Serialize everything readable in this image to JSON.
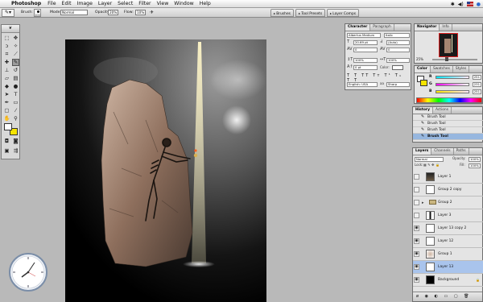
{
  "menubar": {
    "app_name": "Photoshop",
    "items": [
      "File",
      "Edit",
      "Image",
      "Layer",
      "Select",
      "Filter",
      "View",
      "Window",
      "Help"
    ]
  },
  "options_bar": {
    "brush_label": "Brush:",
    "brush_size": "200",
    "mode_label": "Mode:",
    "mode_value": "Normal",
    "opacity_label": "Opacity:",
    "opacity_value": "20%",
    "flow_label": "Flow:",
    "flow_value": "10%",
    "well_tabs": [
      "Brushes",
      "Tool Presets",
      "Layer Comps"
    ]
  },
  "character_palette": {
    "tabs": [
      "Character",
      "Paragraph"
    ],
    "font_family": "Albertus Medium",
    "font_style": "Italic",
    "font_size": "20.69 pt",
    "leading": "(Auto)",
    "kerning": "0",
    "tracking": "0",
    "vertical_scale": "100%",
    "horizontal_scale": "100%",
    "baseline_shift": "0 pt",
    "color_label": "Color:",
    "language": "English: USA",
    "antialias": "Sharp"
  },
  "navigator_palette": {
    "tabs": [
      "Navigator",
      "Info"
    ],
    "zoom": "25%"
  },
  "color_palette": {
    "tabs": [
      "Color",
      "Swatches",
      "Styles"
    ],
    "channels": [
      {
        "label": "R",
        "value": "251"
      },
      {
        "label": "G",
        "value": "231"
      },
      {
        "label": "B",
        "value": "251"
      }
    ]
  },
  "history_palette": {
    "tabs": [
      "History",
      "Actions"
    ],
    "items": [
      {
        "label": "Brush Tool"
      },
      {
        "label": "Brush Tool"
      },
      {
        "label": "Brush Tool"
      },
      {
        "label": "Brush Tool"
      }
    ]
  },
  "layers_palette": {
    "tabs": [
      "Layers",
      "Channels",
      "Paths"
    ],
    "blend_mode": "Normal",
    "opacity_label": "Opacity:",
    "opacity_value": "100%",
    "lock_label": "Lock:",
    "fill_label": "Fill:",
    "fill_value": "100%",
    "layers": [
      {
        "name": "Layer 1"
      },
      {
        "name": "Group 2 copy"
      },
      {
        "name": "Group 2"
      },
      {
        "name": "Layer 3"
      },
      {
        "name": "Layer 13 copy 2"
      },
      {
        "name": "Layer 12"
      },
      {
        "name": "Group 1"
      },
      {
        "name": "Layer 13"
      },
      {
        "name": "Background"
      }
    ]
  },
  "colors": {
    "foreground": "#ffffff",
    "background": "#f6e400",
    "selection": "#a9c4ec"
  }
}
